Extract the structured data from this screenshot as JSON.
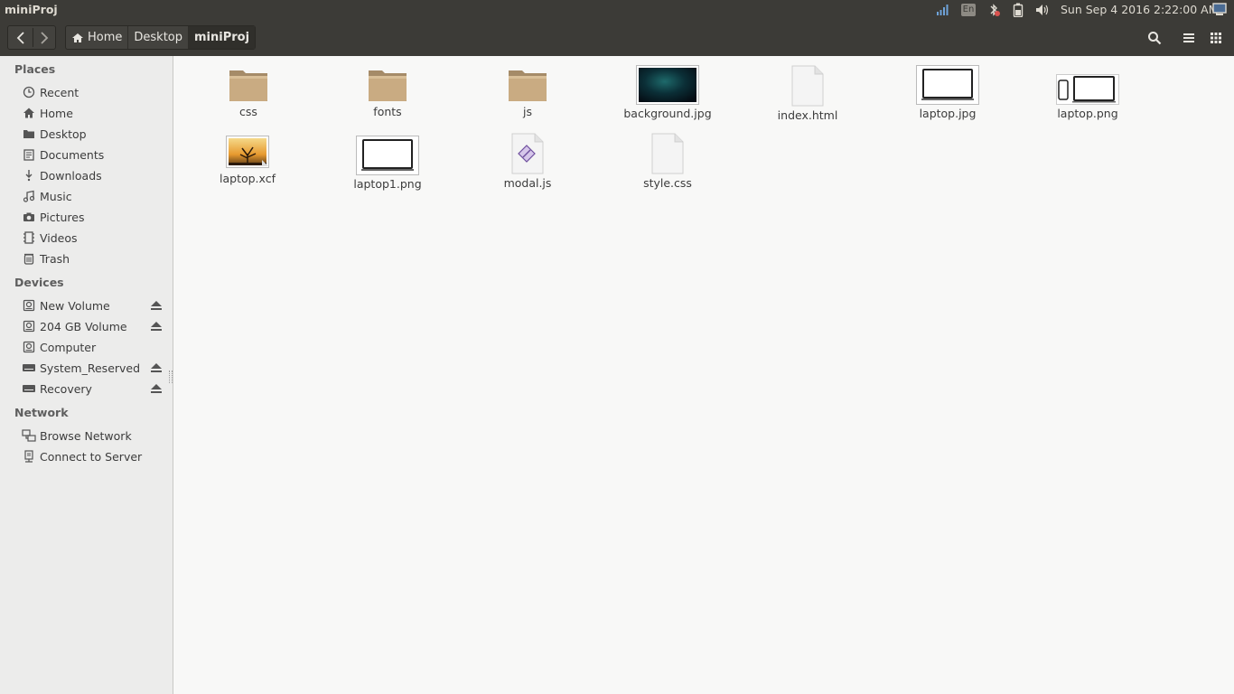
{
  "window": {
    "title": "miniProj"
  },
  "panel": {
    "keyboard_layout": "En",
    "clock": "Sun Sep  4 2016 2:22:00 AM",
    "icons": [
      "network-signal-icon",
      "keyboard-icon",
      "bluetooth-icon",
      "battery-icon",
      "volume-icon",
      "session-icon"
    ]
  },
  "toolbar": {
    "back_icon": "chevron-left-icon",
    "forward_icon": "chevron-right-icon",
    "breadcrumb": [
      "Home",
      "Desktop",
      "miniProj"
    ],
    "search_icon": "search-icon",
    "list_view_icon": "list-view-icon",
    "grid_view_icon": "grid-view-icon"
  },
  "sidebar": {
    "places_label": "Places",
    "places": [
      {
        "label": "Recent",
        "icon": "clock-icon"
      },
      {
        "label": "Home",
        "icon": "home-icon"
      },
      {
        "label": "Desktop",
        "icon": "folder-icon"
      },
      {
        "label": "Documents",
        "icon": "document-icon"
      },
      {
        "label": "Downloads",
        "icon": "download-icon"
      },
      {
        "label": "Music",
        "icon": "music-icon"
      },
      {
        "label": "Pictures",
        "icon": "camera-icon"
      },
      {
        "label": "Videos",
        "icon": "film-icon"
      },
      {
        "label": "Trash",
        "icon": "trash-icon"
      }
    ],
    "devices_label": "Devices",
    "devices": [
      {
        "label": "New Volume",
        "icon": "drive-icon",
        "eject": true
      },
      {
        "label": "204 GB Volume",
        "icon": "drive-icon",
        "eject": true
      },
      {
        "label": "Computer",
        "icon": "drive-icon",
        "eject": false
      },
      {
        "label": "System_Reserved",
        "icon": "disk-icon",
        "eject": true
      },
      {
        "label": "Recovery",
        "icon": "disk-icon",
        "eject": true
      }
    ],
    "network_label": "Network",
    "network": [
      {
        "label": "Browse Network",
        "icon": "network-icon"
      },
      {
        "label": "Connect to Server",
        "icon": "server-icon"
      }
    ]
  },
  "files": [
    {
      "name": "css",
      "kind": "folder"
    },
    {
      "name": "fonts",
      "kind": "folder"
    },
    {
      "name": "js",
      "kind": "folder"
    },
    {
      "name": "background.jpg",
      "kind": "image-dark"
    },
    {
      "name": "index.html",
      "kind": "document"
    },
    {
      "name": "laptop.jpg",
      "kind": "image-laptop"
    },
    {
      "name": "laptop.png",
      "kind": "image-devices"
    },
    {
      "name": "laptop.xcf",
      "kind": "image-gimp"
    },
    {
      "name": "laptop1.png",
      "kind": "image-laptop"
    },
    {
      "name": "modal.js",
      "kind": "script"
    },
    {
      "name": "style.css",
      "kind": "document"
    }
  ]
}
